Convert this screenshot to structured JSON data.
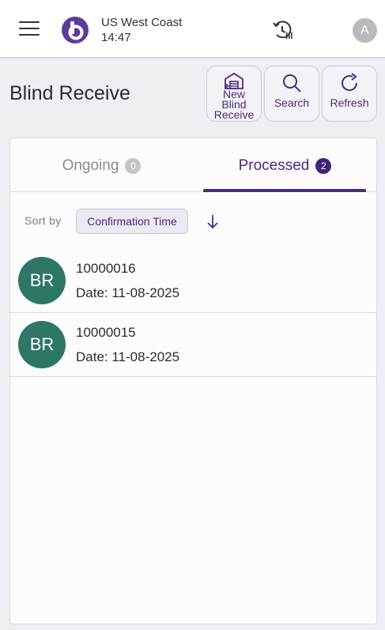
{
  "topbar": {
    "location": "US West Coast",
    "time": "14:47",
    "avatar_initial": "A",
    "brand_color": "#5b3c9c"
  },
  "header": {
    "title": "Blind Receive",
    "buttons": {
      "new_label": "New Blind Receive",
      "search_label": "Search",
      "refresh_label": "Refresh"
    }
  },
  "tabs": {
    "ongoing": {
      "label": "Ongoing",
      "count": "0"
    },
    "processed": {
      "label": "Processed",
      "count": "2",
      "active": true
    }
  },
  "sort": {
    "label": "Sort by",
    "field": "Confirmation Time",
    "direction_icon": "arrow-down-icon"
  },
  "items": [
    {
      "initials": "BR",
      "number": "10000016",
      "date": "Date: 11-08-2025"
    },
    {
      "initials": "BR",
      "number": "10000015",
      "date": "Date: 11-08-2025"
    }
  ],
  "colors": {
    "accent": "#4a2a82",
    "avatar_green": "#2d7764",
    "background": "#efeef3"
  }
}
